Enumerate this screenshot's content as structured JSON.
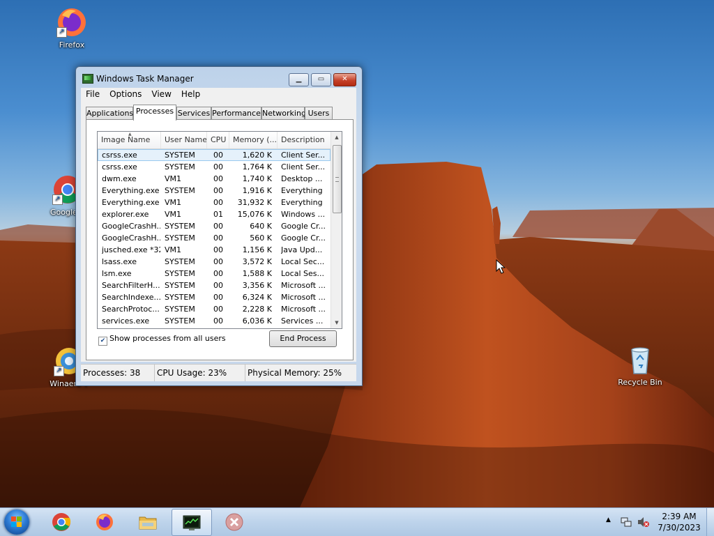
{
  "desktop": {
    "icons": [
      {
        "label": "Firefox"
      },
      {
        "label": "Google C"
      },
      {
        "label": "Winaero T"
      },
      {
        "label": "Recycle Bin"
      }
    ]
  },
  "window": {
    "title": "Windows Task Manager",
    "menu": [
      "File",
      "Options",
      "View",
      "Help"
    ],
    "tabs": [
      "Applications",
      "Processes",
      "Services",
      "Performance",
      "Networking",
      "Users"
    ],
    "active_tab": "Processes",
    "columns": [
      "Image Name",
      "User Name",
      "CPU",
      "Memory (...",
      "Description"
    ],
    "rows": [
      {
        "name": "csrss.exe",
        "user": "SYSTEM",
        "cpu": "00",
        "mem": "1,620 K",
        "desc": "Client Ser..."
      },
      {
        "name": "csrss.exe",
        "user": "SYSTEM",
        "cpu": "00",
        "mem": "1,764 K",
        "desc": "Client Ser..."
      },
      {
        "name": "dwm.exe",
        "user": "VM1",
        "cpu": "00",
        "mem": "1,740 K",
        "desc": "Desktop ..."
      },
      {
        "name": "Everything.exe",
        "user": "SYSTEM",
        "cpu": "00",
        "mem": "1,916 K",
        "desc": "Everything"
      },
      {
        "name": "Everything.exe",
        "user": "VM1",
        "cpu": "00",
        "mem": "31,932 K",
        "desc": "Everything"
      },
      {
        "name": "explorer.exe",
        "user": "VM1",
        "cpu": "01",
        "mem": "15,076 K",
        "desc": "Windows ..."
      },
      {
        "name": "GoogleCrashH...",
        "user": "SYSTEM",
        "cpu": "00",
        "mem": "640 K",
        "desc": "Google Cr..."
      },
      {
        "name": "GoogleCrashH...",
        "user": "SYSTEM",
        "cpu": "00",
        "mem": "560 K",
        "desc": "Google Cr..."
      },
      {
        "name": "jusched.exe *32",
        "user": "VM1",
        "cpu": "00",
        "mem": "1,156 K",
        "desc": "Java Upd..."
      },
      {
        "name": "lsass.exe",
        "user": "SYSTEM",
        "cpu": "00",
        "mem": "3,572 K",
        "desc": "Local Sec..."
      },
      {
        "name": "lsm.exe",
        "user": "SYSTEM",
        "cpu": "00",
        "mem": "1,588 K",
        "desc": "Local Ses..."
      },
      {
        "name": "SearchFilterH...",
        "user": "SYSTEM",
        "cpu": "00",
        "mem": "3,356 K",
        "desc": "Microsoft ..."
      },
      {
        "name": "SearchIndexe...",
        "user": "SYSTEM",
        "cpu": "00",
        "mem": "6,324 K",
        "desc": "Microsoft ..."
      },
      {
        "name": "SearchProtoc...",
        "user": "SYSTEM",
        "cpu": "00",
        "mem": "2,228 K",
        "desc": "Microsoft ..."
      },
      {
        "name": "services.exe",
        "user": "SYSTEM",
        "cpu": "00",
        "mem": "6,036 K",
        "desc": "Services ..."
      }
    ],
    "show_all_label": "Show processes from all users",
    "show_all_checked": true,
    "end_process_label": "End Process",
    "status": {
      "processes": "Processes: 38",
      "cpu": "CPU Usage: 23%",
      "memory": "Physical Memory: 25%"
    }
  },
  "taskbar": {
    "items": [
      "start-orb",
      "chrome",
      "firefox",
      "file-explorer",
      "task-manager",
      "unknown-app"
    ],
    "clock_time": "2:39 AM",
    "clock_date": "7/30/2023"
  }
}
